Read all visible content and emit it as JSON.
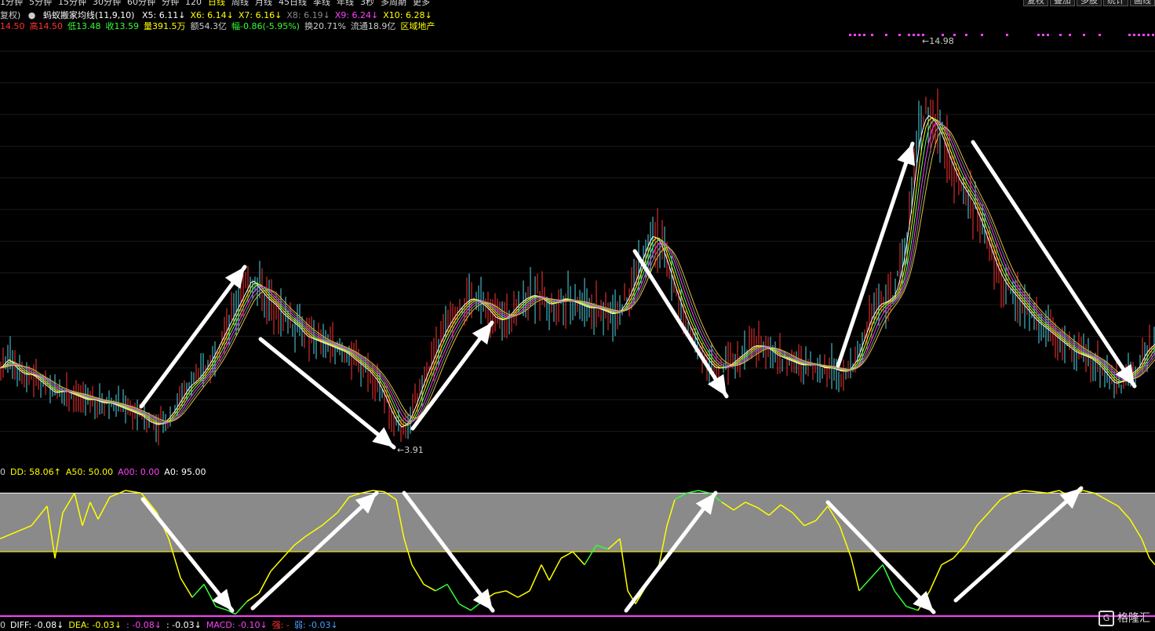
{
  "nav": {
    "items": [
      "1分钟",
      "5分钟",
      "15分钟",
      "30分钟",
      "60分钟",
      "分钟",
      "120",
      "日线",
      "周线",
      "月线",
      "45日线",
      "季线",
      "年线",
      "3秒",
      "多周期",
      "更多"
    ],
    "right_buttons": [
      "复权",
      "叠加",
      "多股",
      "统计",
      "画线"
    ]
  },
  "ma_bar": {
    "fuquan": "复权)",
    "indicator_name": "蚂蚁搬家均线(11,9,10)",
    "items": [
      {
        "label": "X5: 6.11↓",
        "color": "#ffffff"
      },
      {
        "label": "X6: 6.14↓",
        "color": "#ffff00"
      },
      {
        "label": "X7: 6.16↓",
        "color": "#ffff00"
      },
      {
        "label": "X8: 6.19↓",
        "color": "#888888"
      },
      {
        "label": "X9: 6.24↓",
        "color": "#ff40ff"
      },
      {
        "label": "X10: 6.28↓",
        "color": "#ffff00"
      }
    ]
  },
  "price_bar": {
    "items": [
      {
        "label": "14.50",
        "color": "#ff3333"
      },
      {
        "label": "高14.50",
        "color": "#ff3333"
      },
      {
        "label": "低13.48",
        "color": "#33ff33"
      },
      {
        "label": "收13.59",
        "color": "#33ff33"
      },
      {
        "label": "量391.5万",
        "color": "#ffff00"
      },
      {
        "label": "额54.3亿",
        "color": "#cccccc"
      },
      {
        "label": "幅-0.86(-5.95%)",
        "color": "#33ff33"
      },
      {
        "label": "换20.71%",
        "color": "#cccccc"
      },
      {
        "label": "流通18.9亿",
        "color": "#cccccc"
      },
      {
        "label": "区域地产",
        "color": "#ffff00"
      }
    ]
  },
  "ind_bar": {
    "items": [
      {
        "label": "0",
        "color": "#cccccc"
      },
      {
        "label": "DD: 58.06↑",
        "color": "#ffff00"
      },
      {
        "label": "A50: 50.00",
        "color": "#ffff00"
      },
      {
        "label": "A00: 0.00",
        "color": "#ff40ff"
      },
      {
        "label": "A0: 95.00",
        "color": "#ffffff"
      }
    ]
  },
  "macd_bar": {
    "items": [
      {
        "label": "0",
        "color": "#cccccc"
      },
      {
        "label": "DIFF: -0.08↓",
        "color": "#ffffff"
      },
      {
        "label": "DEA: -0.03↓",
        "color": "#ffff00"
      },
      {
        "label": ": -0.08↓",
        "color": "#ff40ff"
      },
      {
        "label": ": -0.03↓",
        "color": "#ffffff"
      },
      {
        "label": "MACD: -0.10↓",
        "color": "#ff40ff"
      },
      {
        "label": "强: -",
        "color": "#ff3333"
      },
      {
        "label": "弱: -0.03↓",
        "color": "#4aa0ff"
      }
    ]
  },
  "chart_data": [
    {
      "type": "line",
      "title": "蚂蚁搬家均线(11,9,10)",
      "ylim": [
        3.0,
        16.5
      ],
      "high_label": "14.98",
      "low_label": "3.91",
      "price_points": [
        [
          0,
          6.0
        ],
        [
          10,
          6.3
        ],
        [
          20,
          6.0
        ],
        [
          30,
          5.8
        ],
        [
          40,
          5.8
        ],
        [
          50,
          5.6
        ],
        [
          60,
          5.4
        ],
        [
          70,
          5.2
        ],
        [
          80,
          5.3
        ],
        [
          90,
          5.2
        ],
        [
          100,
          5.1
        ],
        [
          110,
          5.0
        ],
        [
          120,
          5.0
        ],
        [
          130,
          4.9
        ],
        [
          140,
          4.9
        ],
        [
          150,
          4.8
        ],
        [
          160,
          4.7
        ],
        [
          170,
          4.6
        ],
        [
          180,
          4.5
        ],
        [
          190,
          4.3
        ],
        [
          200,
          4.2
        ],
        [
          210,
          4.3
        ],
        [
          220,
          4.6
        ],
        [
          230,
          5.0
        ],
        [
          240,
          5.4
        ],
        [
          250,
          5.6
        ],
        [
          260,
          5.9
        ],
        [
          270,
          6.3
        ],
        [
          280,
          6.8
        ],
        [
          290,
          7.3
        ],
        [
          300,
          7.8
        ],
        [
          310,
          8.3
        ],
        [
          320,
          8.8
        ],
        [
          330,
          8.5
        ],
        [
          340,
          8.2
        ],
        [
          350,
          8.0
        ],
        [
          360,
          7.7
        ],
        [
          370,
          7.5
        ],
        [
          380,
          7.3
        ],
        [
          390,
          7.0
        ],
        [
          400,
          6.9
        ],
        [
          410,
          6.8
        ],
        [
          420,
          6.7
        ],
        [
          430,
          6.6
        ],
        [
          440,
          6.5
        ],
        [
          450,
          6.3
        ],
        [
          460,
          6.1
        ],
        [
          470,
          5.9
        ],
        [
          480,
          5.6
        ],
        [
          490,
          5.1
        ],
        [
          500,
          4.5
        ],
        [
          510,
          4.1
        ],
        [
          520,
          4.3
        ],
        [
          530,
          4.9
        ],
        [
          540,
          5.6
        ],
        [
          550,
          6.2
        ],
        [
          560,
          6.8
        ],
        [
          570,
          7.3
        ],
        [
          580,
          7.7
        ],
        [
          590,
          8.0
        ],
        [
          600,
          8.2
        ],
        [
          610,
          8.1
        ],
        [
          620,
          7.9
        ],
        [
          630,
          7.6
        ],
        [
          640,
          7.5
        ],
        [
          650,
          7.7
        ],
        [
          660,
          8.0
        ],
        [
          670,
          8.2
        ],
        [
          680,
          8.3
        ],
        [
          690,
          8.2
        ],
        [
          700,
          8.0
        ],
        [
          710,
          8.1
        ],
        [
          720,
          8.2
        ],
        [
          730,
          8.1
        ],
        [
          740,
          8.0
        ],
        [
          750,
          7.9
        ],
        [
          760,
          7.9
        ],
        [
          770,
          7.8
        ],
        [
          780,
          7.7
        ],
        [
          790,
          7.8
        ],
        [
          800,
          8.2
        ],
        [
          810,
          8.8
        ],
        [
          820,
          9.6
        ],
        [
          830,
          10.2
        ],
        [
          840,
          10.0
        ],
        [
          850,
          9.3
        ],
        [
          860,
          8.5
        ],
        [
          870,
          7.8
        ],
        [
          880,
          7.2
        ],
        [
          890,
          6.7
        ],
        [
          900,
          6.3
        ],
        [
          910,
          6.0
        ],
        [
          920,
          6.0
        ],
        [
          930,
          6.1
        ],
        [
          940,
          6.3
        ],
        [
          950,
          6.5
        ],
        [
          960,
          6.7
        ],
        [
          970,
          6.7
        ],
        [
          980,
          6.6
        ],
        [
          990,
          6.4
        ],
        [
          1000,
          6.3
        ],
        [
          1010,
          6.2
        ],
        [
          1020,
          6.1
        ],
        [
          1030,
          6.1
        ],
        [
          1040,
          6.1
        ],
        [
          1050,
          6.0
        ],
        [
          1060,
          6.0
        ],
        [
          1070,
          5.9
        ],
        [
          1080,
          5.9
        ],
        [
          1090,
          6.2
        ],
        [
          1100,
          6.9
        ],
        [
          1110,
          7.6
        ],
        [
          1120,
          8.0
        ],
        [
          1130,
          8.1
        ],
        [
          1140,
          8.3
        ],
        [
          1150,
          9.3
        ],
        [
          1160,
          11.0
        ],
        [
          1170,
          13.2
        ],
        [
          1180,
          14.0
        ],
        [
          1190,
          13.8
        ],
        [
          1200,
          13.3
        ],
        [
          1210,
          12.6
        ],
        [
          1220,
          12.0
        ],
        [
          1230,
          11.6
        ],
        [
          1240,
          11.2
        ],
        [
          1250,
          10.6
        ],
        [
          1260,
          9.9
        ],
        [
          1270,
          9.2
        ],
        [
          1280,
          8.7
        ],
        [
          1290,
          8.4
        ],
        [
          1300,
          8.1
        ],
        [
          1310,
          7.8
        ],
        [
          1320,
          7.5
        ],
        [
          1330,
          7.3
        ],
        [
          1340,
          7.1
        ],
        [
          1350,
          6.9
        ],
        [
          1360,
          6.7
        ],
        [
          1370,
          6.5
        ],
        [
          1380,
          6.4
        ],
        [
          1390,
          6.3
        ],
        [
          1400,
          6.1
        ],
        [
          1410,
          5.8
        ],
        [
          1420,
          5.5
        ],
        [
          1430,
          5.6
        ],
        [
          1440,
          5.8
        ],
        [
          1450,
          6.0
        ],
        [
          1460,
          6.5
        ],
        [
          1472,
          6.8
        ]
      ],
      "annotations": [
        "↑",
        "↓",
        "↑",
        "↓",
        "↑",
        "↓"
      ]
    },
    {
      "type": "line",
      "title": "DD",
      "ylim": [
        0,
        100
      ],
      "levels": {
        "A0": 95,
        "A50": 50,
        "A00": 0
      },
      "dd_points": [
        [
          0,
          60
        ],
        [
          20,
          65
        ],
        [
          40,
          70
        ],
        [
          60,
          85
        ],
        [
          70,
          45
        ],
        [
          80,
          80
        ],
        [
          95,
          95
        ],
        [
          105,
          70
        ],
        [
          115,
          88
        ],
        [
          125,
          75
        ],
        [
          140,
          92
        ],
        [
          160,
          97
        ],
        [
          180,
          95
        ],
        [
          200,
          80
        ],
        [
          215,
          60
        ],
        [
          230,
          30
        ],
        [
          245,
          15
        ],
        [
          260,
          25
        ],
        [
          275,
          8
        ],
        [
          290,
          5
        ],
        [
          300,
          2
        ],
        [
          315,
          12
        ],
        [
          330,
          18
        ],
        [
          345,
          35
        ],
        [
          360,
          45
        ],
        [
          375,
          55
        ],
        [
          390,
          62
        ],
        [
          410,
          70
        ],
        [
          430,
          80
        ],
        [
          445,
          92
        ],
        [
          460,
          95
        ],
        [
          475,
          97
        ],
        [
          490,
          96
        ],
        [
          505,
          90
        ],
        [
          515,
          60
        ],
        [
          525,
          40
        ],
        [
          540,
          25
        ],
        [
          555,
          20
        ],
        [
          570,
          25
        ],
        [
          585,
          10
        ],
        [
          600,
          5
        ],
        [
          615,
          12
        ],
        [
          630,
          18
        ],
        [
          645,
          20
        ],
        [
          660,
          15
        ],
        [
          675,
          20
        ],
        [
          690,
          40
        ],
        [
          700,
          28
        ],
        [
          715,
          45
        ],
        [
          730,
          50
        ],
        [
          745,
          40
        ],
        [
          760,
          55
        ],
        [
          775,
          52
        ],
        [
          790,
          60
        ],
        [
          800,
          20
        ],
        [
          810,
          10
        ],
        [
          825,
          25
        ],
        [
          840,
          40
        ],
        [
          850,
          70
        ],
        [
          860,
          90
        ],
        [
          875,
          95
        ],
        [
          890,
          97
        ],
        [
          905,
          95
        ],
        [
          920,
          88
        ],
        [
          935,
          82
        ],
        [
          950,
          88
        ],
        [
          965,
          84
        ],
        [
          980,
          78
        ],
        [
          995,
          86
        ],
        [
          1010,
          80
        ],
        [
          1025,
          70
        ],
        [
          1040,
          74
        ],
        [
          1055,
          85
        ],
        [
          1070,
          70
        ],
        [
          1085,
          45
        ],
        [
          1095,
          20
        ],
        [
          1110,
          30
        ],
        [
          1125,
          40
        ],
        [
          1140,
          20
        ],
        [
          1155,
          8
        ],
        [
          1170,
          5
        ],
        [
          1185,
          20
        ],
        [
          1200,
          40
        ],
        [
          1215,
          45
        ],
        [
          1230,
          55
        ],
        [
          1245,
          70
        ],
        [
          1260,
          80
        ],
        [
          1275,
          90
        ],
        [
          1290,
          95
        ],
        [
          1305,
          97
        ],
        [
          1320,
          96
        ],
        [
          1335,
          95
        ],
        [
          1350,
          97
        ],
        [
          1365,
          92
        ],
        [
          1380,
          97
        ],
        [
          1395,
          95
        ],
        [
          1410,
          90
        ],
        [
          1425,
          85
        ],
        [
          1440,
          75
        ],
        [
          1455,
          60
        ],
        [
          1465,
          45
        ],
        [
          1472,
          40
        ]
      ],
      "annotations": [
        "↓",
        "↑",
        "↓",
        "↑",
        "↓",
        "↑"
      ]
    }
  ]
}
